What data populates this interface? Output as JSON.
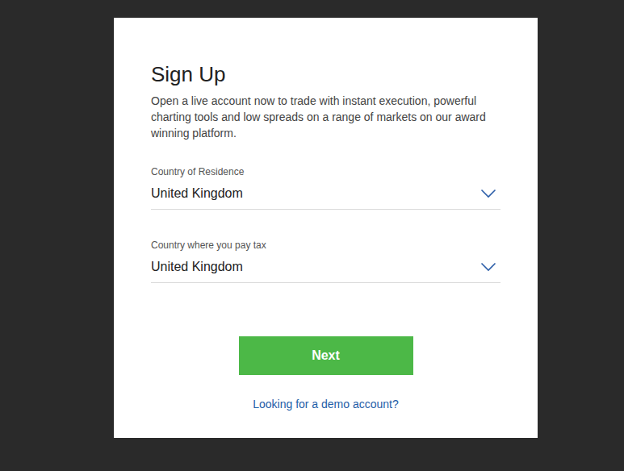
{
  "dialog": {
    "title": "Sign Up",
    "description": "Open a live account now to trade with instant execution, powerful charting tools and low spreads on a range of markets on our award winning platform."
  },
  "fields": [
    {
      "label": "Country of Residence",
      "value": "United Kingdom"
    },
    {
      "label": "Country where you pay tax",
      "value": "United Kingdom"
    }
  ],
  "next_button": "Next",
  "demo_link": "Looking for a demo account?"
}
